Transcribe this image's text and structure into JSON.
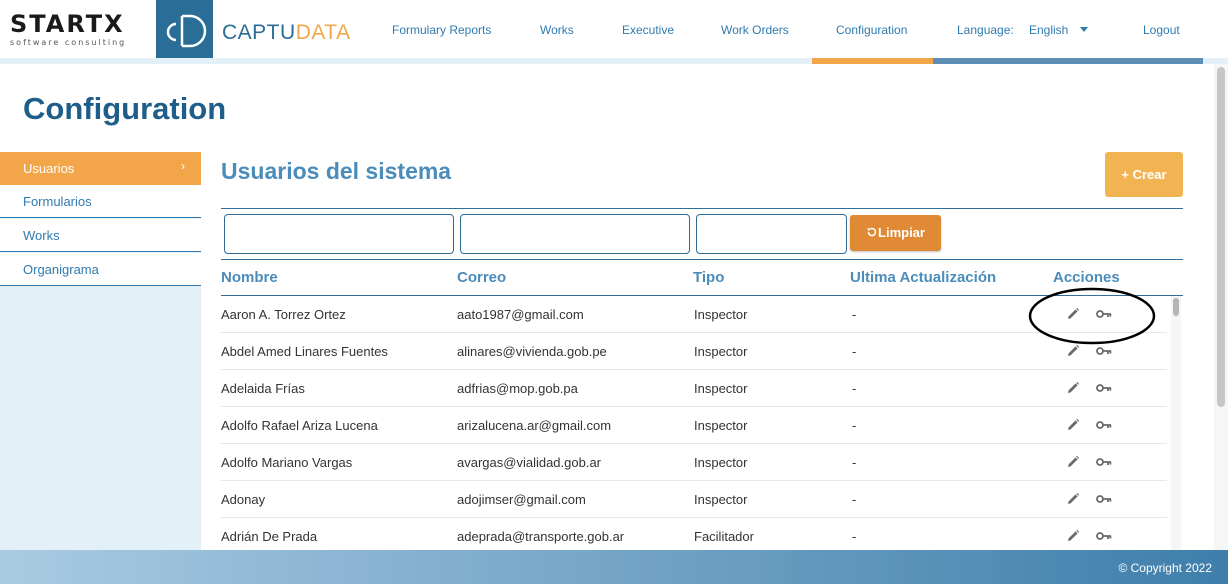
{
  "brand": {
    "startx_word": "STARTX",
    "startx_tagline": "software consulting",
    "cd_mark": "cD",
    "name_part1": "CAPTU",
    "name_part2": "DATA"
  },
  "nav": {
    "items": [
      {
        "label": "Formulary Reports"
      },
      {
        "label": "Works"
      },
      {
        "label": "Executive"
      },
      {
        "label": "Work Orders"
      },
      {
        "label": "Configuration"
      }
    ],
    "language_label": "Language:",
    "language_value": "English",
    "logout": "Logout"
  },
  "page": {
    "title": "Configuration"
  },
  "sidebar": {
    "items": [
      {
        "label": "Usuarios",
        "active": true
      },
      {
        "label": "Formularios"
      },
      {
        "label": "Works"
      },
      {
        "label": "Organigrama"
      }
    ]
  },
  "content": {
    "title": "Usuarios del sistema",
    "create_button": "+ Crear",
    "clear_button": "Limpiar",
    "filters": [
      {
        "value": ""
      },
      {
        "value": ""
      },
      {
        "value": ""
      }
    ]
  },
  "table": {
    "headers": [
      "Nombre",
      "Correo",
      "Tipo",
      "Ultima Actualización",
      "Acciones"
    ],
    "rows": [
      {
        "nombre": "Aaron A. Torrez Ortez",
        "correo": "aato1987@gmail.com",
        "tipo": "Inspector",
        "ultima": "-"
      },
      {
        "nombre": "Abdel Amed Linares Fuentes",
        "correo": "alinares@vivienda.gob.pe",
        "tipo": "Inspector",
        "ultima": "-"
      },
      {
        "nombre": "Adelaida Frías",
        "correo": "adfrias@mop.gob.pa",
        "tipo": "Inspector",
        "ultima": "-"
      },
      {
        "nombre": "Adolfo Rafael Ariza Lucena",
        "correo": "arizalucena.ar@gmail.com",
        "tipo": "Inspector",
        "ultima": "-"
      },
      {
        "nombre": "Adolfo Mariano Vargas",
        "correo": "avargas@vialidad.gob.ar",
        "tipo": "Inspector",
        "ultima": "-"
      },
      {
        "nombre": "Adonay",
        "correo": "adojimser@gmail.com",
        "tipo": "Inspector",
        "ultima": "-"
      },
      {
        "nombre": "Adrián De Prada",
        "correo": "adeprada@transporte.gob.ar",
        "tipo": "Facilitador",
        "ultima": "-"
      }
    ],
    "row_actions": [
      "pencil-icon",
      "key-icon"
    ]
  },
  "footer": {
    "copyright": "© Copyright 2022"
  },
  "colors": {
    "accent_orange": "#f2a649",
    "button_orange": "#e08a35",
    "primary_blue": "#2a6d96",
    "link_blue": "#2f7bb0",
    "sidebar_bg": "#e4f0f7"
  }
}
